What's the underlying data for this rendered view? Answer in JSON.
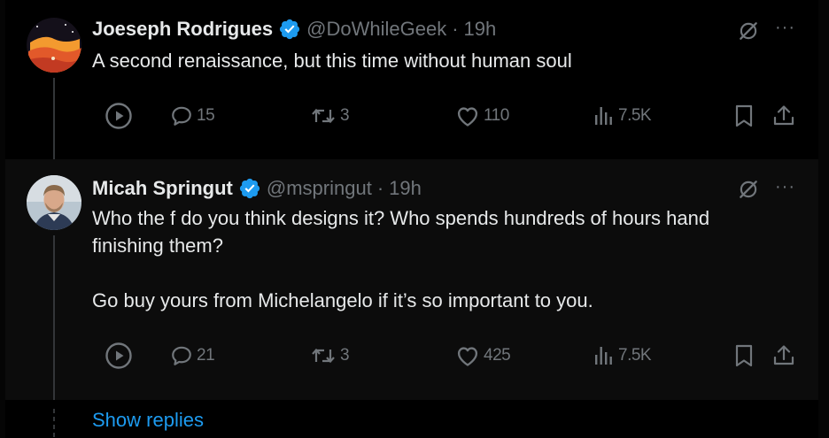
{
  "tweets": [
    {
      "author_name": "Joeseph Rodrigues",
      "handle": "@DoWhileGeek",
      "separator": "·",
      "time": "19h",
      "paragraphs": [
        "A second renaissance, but this time without human soul"
      ],
      "actions": {
        "replies": "15",
        "reposts": "3",
        "likes": "110",
        "views": "7.5K"
      },
      "avatar_icon": "sunset-landscape-avatar",
      "more_label": "···"
    },
    {
      "author_name": "Micah Springut",
      "handle": "@mspringut",
      "separator": "·",
      "time": "19h",
      "paragraphs": [
        "Who the f do you think designs it? Who spends hundreds of hours hand finishing them?",
        "Go buy yours from Michelangelo if it’s so important to you."
      ],
      "actions": {
        "replies": "21",
        "reposts": "3",
        "likes": "425",
        "views": "7.5K"
      },
      "avatar_icon": "person-photo-avatar",
      "more_label": "···"
    }
  ],
  "show_replies_label": "Show replies",
  "colors": {
    "background": "#000000",
    "text": "#e7e9ea",
    "muted": "#71767b",
    "accent": "#1d9bf0",
    "verified": "#1d9bf0"
  },
  "icons": [
    "play-icon",
    "reply-icon",
    "repost-icon",
    "like-icon",
    "views-icon",
    "bookmark-icon",
    "share-icon",
    "grok-icon",
    "more-icon",
    "verified-badge-icon"
  ]
}
